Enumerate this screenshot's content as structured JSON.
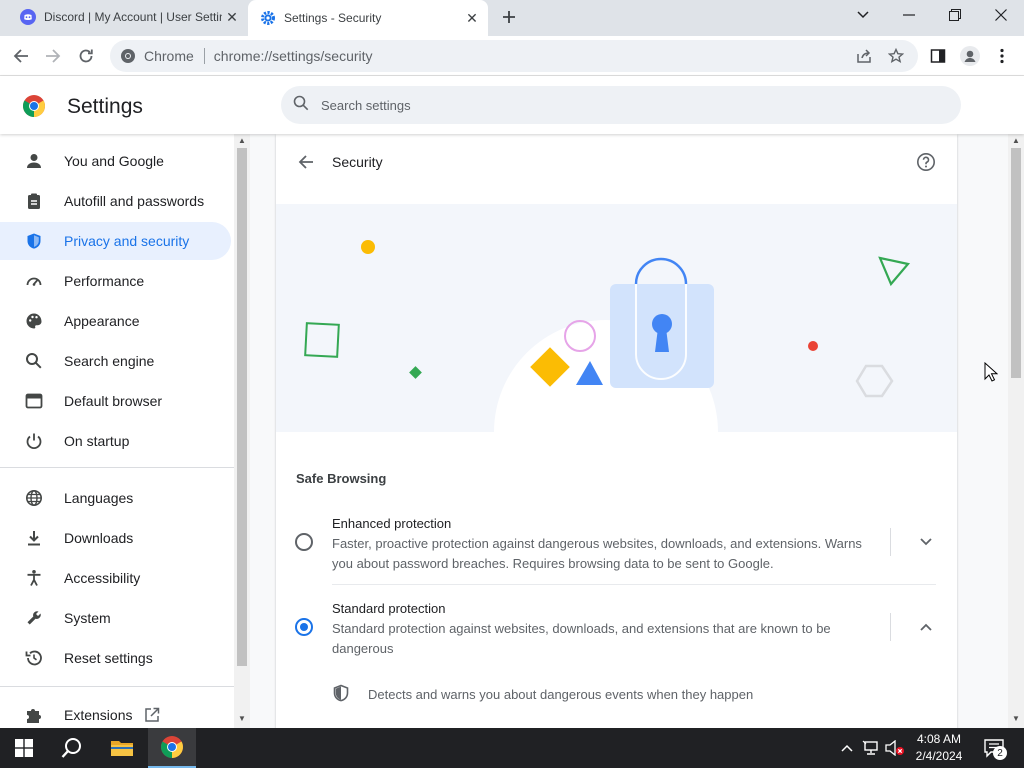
{
  "browser": {
    "tabs": [
      {
        "title": "Discord | My Account | User Settings",
        "icon": "discord-icon",
        "active": false
      },
      {
        "title": "Settings - Security",
        "icon": "settings-gear-icon",
        "active": true
      }
    ],
    "omnibox": {
      "site_label": "Chrome",
      "url": "chrome://settings/security"
    }
  },
  "settings": {
    "title": "Settings",
    "search_placeholder": "Search settings",
    "sidebar": [
      {
        "label": "You and Google",
        "icon": "person-icon",
        "active": false
      },
      {
        "label": "Autofill and passwords",
        "icon": "clipboard-icon",
        "active": false
      },
      {
        "label": "Privacy and security",
        "icon": "shield-icon",
        "active": true
      },
      {
        "label": "Performance",
        "icon": "speedometer-icon",
        "active": false
      },
      {
        "label": "Appearance",
        "icon": "palette-icon",
        "active": false
      },
      {
        "label": "Search engine",
        "icon": "search-icon",
        "active": false
      },
      {
        "label": "Default browser",
        "icon": "browser-window-icon",
        "active": false
      },
      {
        "label": "On startup",
        "icon": "power-icon",
        "active": false
      },
      {
        "label": "Languages",
        "icon": "globe-icon",
        "active": false
      },
      {
        "label": "Downloads",
        "icon": "download-icon",
        "active": false
      },
      {
        "label": "Accessibility",
        "icon": "accessibility-icon",
        "active": false
      },
      {
        "label": "System",
        "icon": "wrench-icon",
        "active": false
      },
      {
        "label": "Reset settings",
        "icon": "history-icon",
        "active": false
      },
      {
        "label": "Extensions",
        "icon": "puzzle-icon",
        "active": false
      }
    ],
    "page": {
      "title": "Security",
      "section": "Safe Browsing",
      "options": [
        {
          "label": "Enhanced protection",
          "description": "Faster, proactive protection against dangerous websites, downloads, and extensions. Warns you about password breaches. Requires browsing data to be sent to Google.",
          "checked": false,
          "expanded": false
        },
        {
          "label": "Standard protection",
          "description": "Standard protection against websites, downloads, and extensions that are known to be dangerous",
          "checked": true,
          "expanded": true
        }
      ],
      "detail": "Detects and warns you about dangerous events when they happen"
    }
  },
  "taskbar": {
    "time": "4:08 AM",
    "date": "2/4/2024",
    "notification_count": "2"
  },
  "colors": {
    "accent": "#1a73e8",
    "active_nav_bg": "#e8f0fe",
    "taskbar": "#202124"
  }
}
